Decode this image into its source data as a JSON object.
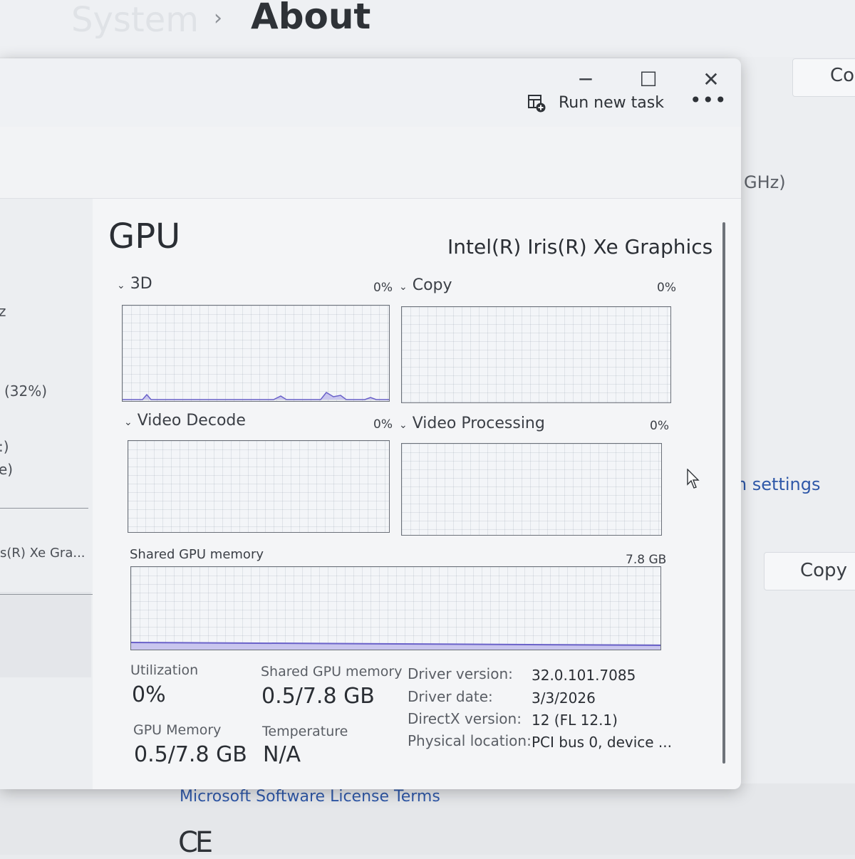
{
  "settings": {
    "breadcrumb_parent": "System",
    "breadcrumb_sep": "›",
    "breadcrumb_current": "About",
    "copy_top": "Co",
    "ghz_fragment": "GHz)",
    "system_settings_fragment": "em settings",
    "copy_mid": "Copy",
    "license_link": "Microsoft Software License Terms",
    "ce_mark": "CE"
  },
  "window": {
    "minimize": "─",
    "maximize": "☐",
    "close": "✕"
  },
  "toolbar": {
    "run_new_task": "Run new task",
    "more_options": "•••"
  },
  "sidebar": {
    "fragment_z": "z",
    "fragment_32": "(32%)",
    "fragment_c": ":)",
    "fragment_e": "e)",
    "gpu_item": "s(R) Xe Gra..."
  },
  "gpu": {
    "heading": "GPU",
    "model": "Intel(R) Iris(R) Xe Graphics",
    "engines": [
      {
        "name": "3D",
        "percent": "0%"
      },
      {
        "name": "Copy",
        "percent": "0%"
      },
      {
        "name": "Video Decode",
        "percent": "0%"
      },
      {
        "name": "Video Processing",
        "percent": "0%"
      }
    ],
    "shared_memory_graph_label": "Shared GPU memory",
    "shared_memory_graph_max": "7.8 GB",
    "stats": {
      "utilization_label": "Utilization",
      "utilization_value": "0%",
      "shared_mem_label": "Shared GPU memory",
      "shared_mem_value": "0.5/7.8 GB",
      "gpu_memory_label": "GPU Memory",
      "gpu_memory_value": "0.5/7.8 GB",
      "temperature_label": "Temperature",
      "temperature_value": "N/A"
    },
    "details": [
      {
        "key": "Driver version:",
        "value": "32.0.101.7085"
      },
      {
        "key": "Driver date:",
        "value": "3/3/2026"
      },
      {
        "key": "DirectX version:",
        "value": "12 (FL 12.1)"
      },
      {
        "key": "Physical location:",
        "value": "PCI bus 0, device ..."
      }
    ]
  },
  "colors": {
    "accent_link": "#2f58a8",
    "graph_line": "#6a62c9",
    "graph_fill": "#c9c6ee"
  }
}
